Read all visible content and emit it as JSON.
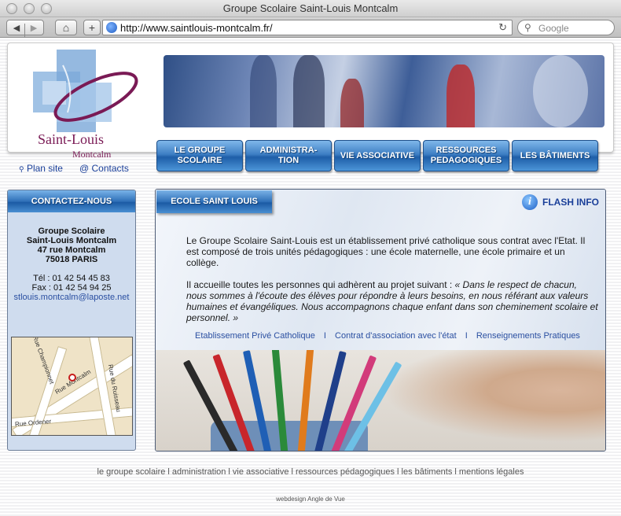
{
  "window": {
    "title": "Groupe Scolaire Saint-Louis Montcalm"
  },
  "toolbar": {
    "url": "http://www.saintlouis-montcalm.fr/",
    "search_placeholder": "Google"
  },
  "logo": {
    "line1": "Saint-Louis",
    "line2": "Montcalm"
  },
  "nav": [
    {
      "label": "LE GROUPE SCOLAIRE"
    },
    {
      "label": "ADMINISTRA- TION"
    },
    {
      "label": "VIE ASSOCIATIVE"
    },
    {
      "label": "RESSOURCES PEDAGOGIQUES"
    },
    {
      "label": "LES BÂTIMENTS"
    }
  ],
  "toplinks": {
    "sitemap": "Plan site",
    "contacts": "@ Contacts"
  },
  "contact": {
    "title": "CONTACTEZ-NOUS",
    "org1": "Groupe Scolaire",
    "org2": "Saint-Louis Montcalm",
    "street": "47 rue Montcalm",
    "city": "75018 PARIS",
    "tel": "Tél : 01 42 54 45 83",
    "fax": "Fax : 01 42 54 94 25",
    "email": "stlouis.montcalm@laposte.net"
  },
  "map": {
    "labels": [
      "Rue Montcalm",
      "Rue du Ruisseau",
      "Rue Ordener",
      "Rue Championnet"
    ]
  },
  "main": {
    "title": "ECOLE SAINT LOUIS",
    "flash": "FLASH INFO",
    "para1": "Le Groupe Scolaire Saint-Louis est un établissement privé catholique sous contrat avec l'Etat. Il est composé de trois unités pédagogiques : une école maternelle, une école primaire et un collège.",
    "para2_lead": "Il accueille toutes les personnes qui adhèrent au projet suivant : ",
    "para2_quote": "« Dans le respect de chacun, nous sommes à l'écoute des élèves pour répondre à leurs besoins, en nous référant aux valeurs humaines et évangéliques. Nous accompagnons chaque enfant dans son cheminement scolaire et personnel. »",
    "links": [
      "Etablissement Privé Catholique",
      "Contrat d'association avec l'état",
      "Renseignements Pratiques"
    ]
  },
  "footer": {
    "links": "le groupe scolaire l administration l vie associative l ressources pédagogiques l les bâtiments l mentions légales",
    "credit": "webdesign Angle de Vue"
  },
  "colors": {
    "nav_blue": "#2f70b8",
    "link_blue": "#1a3f99",
    "logo_purple": "#7a1a55"
  }
}
